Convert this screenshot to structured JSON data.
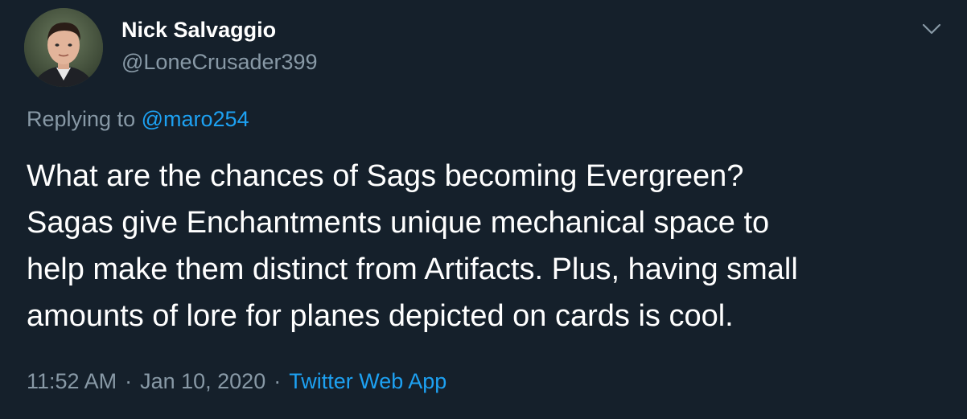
{
  "author": {
    "display_name": "Nick Salvaggio",
    "handle": "@LoneCrusader399"
  },
  "reply": {
    "prefix": "Replying to",
    "mention": "@maro254"
  },
  "tweet": {
    "text": "What are the chances of Sags becoming Evergreen?\nSagas give Enchantments unique mechanical space to\nhelp make them distinct from Artifacts. Plus, having small\namounts of lore for planes depicted on cards is cool."
  },
  "meta": {
    "time": "11:52 AM",
    "separator": "·",
    "date": "Jan 10, 2020",
    "source": "Twitter Web App"
  },
  "icons": {
    "menu": "chevron-down-icon"
  },
  "colors": {
    "background": "#15202b",
    "primary_text": "#ffffff",
    "secondary_text": "#8899a6",
    "accent": "#1da1f2"
  }
}
